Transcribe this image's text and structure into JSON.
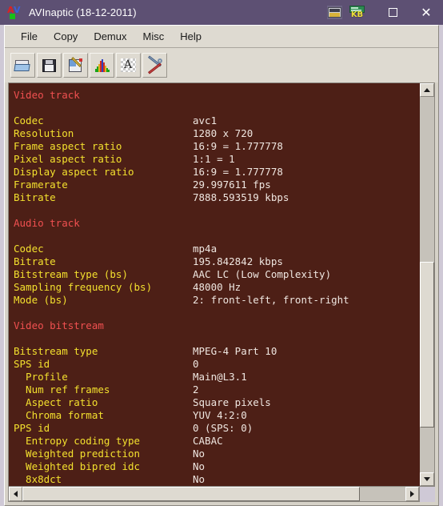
{
  "window": {
    "title": "AVInaptic (18-12-2011)",
    "logo_icon": "avinaptic-logo-icon",
    "tray": [
      {
        "icon": "film-calendar-icon",
        "name": "media-indicator"
      },
      {
        "icon": "kb-size-icon",
        "name": "kilobyte-indicator",
        "label": "KB"
      }
    ],
    "buttons": {
      "maximize": "maximize-icon",
      "close": "close-icon"
    }
  },
  "menu": {
    "items": [
      "File",
      "Copy",
      "Demux",
      "Misc",
      "Help"
    ]
  },
  "toolbar": {
    "buttons": [
      {
        "name": "open-file-button",
        "icon": "open-folder-icon"
      },
      {
        "name": "save-button",
        "icon": "floppy-disk-icon"
      },
      {
        "name": "edit-button",
        "icon": "pencil-document-icon"
      },
      {
        "name": "statistics-button",
        "icon": "histogram-chart-icon"
      },
      {
        "name": "text-view-button",
        "icon": "letter-a-icon"
      },
      {
        "name": "preferences-button",
        "icon": "wrench-screwdriver-icon"
      }
    ]
  },
  "report": {
    "sections": [
      {
        "header": "Video track",
        "rows": [
          {
            "label": "Codec",
            "value": "avc1"
          },
          {
            "label": "Resolution",
            "value": "1280 x 720"
          },
          {
            "label": "Frame aspect ratio",
            "value": "16:9 = 1.777778"
          },
          {
            "label": "Pixel aspect ratio",
            "value": "1:1 = 1"
          },
          {
            "label": "Display aspect ratio",
            "value": "16:9 = 1.777778"
          },
          {
            "label": "Framerate",
            "value": "29.997611 fps"
          },
          {
            "label": "Bitrate",
            "value": "7888.593519 kbps"
          }
        ]
      },
      {
        "header": "Audio track",
        "rows": [
          {
            "label": "Codec",
            "value": "mp4a"
          },
          {
            "label": "Bitrate",
            "value": "195.842842 kbps"
          },
          {
            "label": "Bitstream type (bs)",
            "value": "AAC LC (Low Complexity)"
          },
          {
            "label": "Sampling frequency (bs)",
            "value": "48000 Hz"
          },
          {
            "label": "Mode (bs)",
            "value": "2: front-left, front-right"
          }
        ]
      },
      {
        "header": "Video bitstream",
        "rows": [
          {
            "label": "Bitstream type",
            "value": "MPEG-4 Part 10"
          },
          {
            "label": "SPS id",
            "value": "0"
          },
          {
            "label": "  Profile",
            "value": "Main@L3.1"
          },
          {
            "label": "  Num ref frames",
            "value": "2"
          },
          {
            "label": "  Aspect ratio",
            "value": "Square pixels"
          },
          {
            "label": "  Chroma format",
            "value": "YUV 4:2:0"
          },
          {
            "label": "PPS id",
            "value": "0 (SPS: 0)"
          },
          {
            "label": "  Entropy coding type",
            "value": "CABAC"
          },
          {
            "label": "  Weighted prediction",
            "value": "No"
          },
          {
            "label": "  Weighted bipred idc",
            "value": "No"
          },
          {
            "label": "  8x8dct",
            "value": "No"
          }
        ]
      }
    ]
  },
  "scrollbars": {
    "vertical": {
      "thumb_top_pct": 44,
      "thumb_height_pct": 44
    },
    "horizontal": {
      "thumb_left_pct": 0,
      "thumb_width_pct": 88
    }
  },
  "colors": {
    "titlebar": "#5d5073",
    "content_bg": "#4d1f16",
    "header_text": "#f05050",
    "label_text": "#f3e02e",
    "value_text": "#efe6e0",
    "chrome": "#dedad1"
  }
}
